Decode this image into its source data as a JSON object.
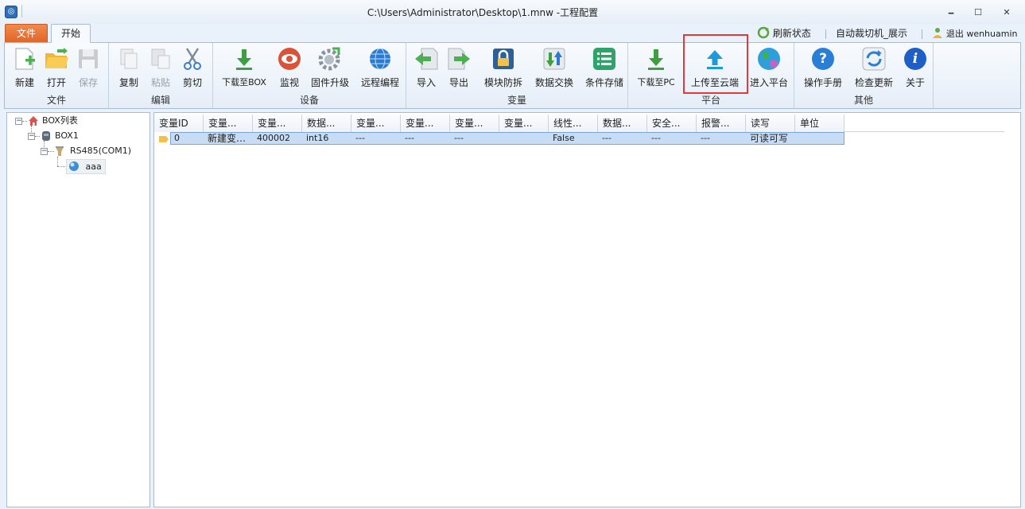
{
  "window": {
    "title": "C:\\Users\\Administrator\\Desktop\\1.mnw -工程配置",
    "controls": {
      "minimize": "🗕",
      "maximize": "☐",
      "close": "✕"
    }
  },
  "tabs": {
    "file": "文件",
    "start": "开始"
  },
  "right_links": {
    "refresh": "刷新状态",
    "auto_switch": "自动裁切机_展示",
    "logout": "退出 wenhuamin"
  },
  "ribbon": {
    "groups": {
      "file": "文件",
      "edit": "编辑",
      "device": "设备",
      "variable": "变量",
      "platform": "平台",
      "other": "其他"
    },
    "buttons": {
      "new": "新建",
      "open": "打开",
      "save": "保存",
      "copy": "复制",
      "paste": "粘贴",
      "cut": "剪切",
      "download_box": "下载至BOX",
      "monitor": "监视",
      "firmware": "固件升级",
      "remote": "远程编程",
      "import": "导入",
      "export": "导出",
      "block_split": "模块防拆",
      "data_exchange": "数据交换",
      "cond_store": "条件存储",
      "download_pc": "下载至PC",
      "upload_cloud": "上传至云端",
      "enter_platform": "进入平台",
      "manual": "操作手册",
      "check_update": "检查更新",
      "about": "关于"
    }
  },
  "tree": {
    "root": "BOX列表",
    "box": "BOX1",
    "port": "RS485(COM1)",
    "item": "aaa"
  },
  "table": {
    "columns": [
      "变量ID",
      "变量...",
      "变量...",
      "数据...",
      "变量...",
      "变量...",
      "变量...",
      "变量...",
      "线性...",
      "数据...",
      "安全...",
      "报警...",
      "读写",
      "单位"
    ],
    "rows": [
      [
        "0",
        "新建变…",
        "400002",
        "int16",
        "---",
        "---",
        "---",
        "",
        "False",
        "---",
        "---",
        "---",
        "可读可写",
        ""
      ]
    ]
  },
  "colors": {
    "accent_file_tab": "#e0642a",
    "highlight_box": "#e03a3a",
    "selection": "#c7ddf5"
  }
}
